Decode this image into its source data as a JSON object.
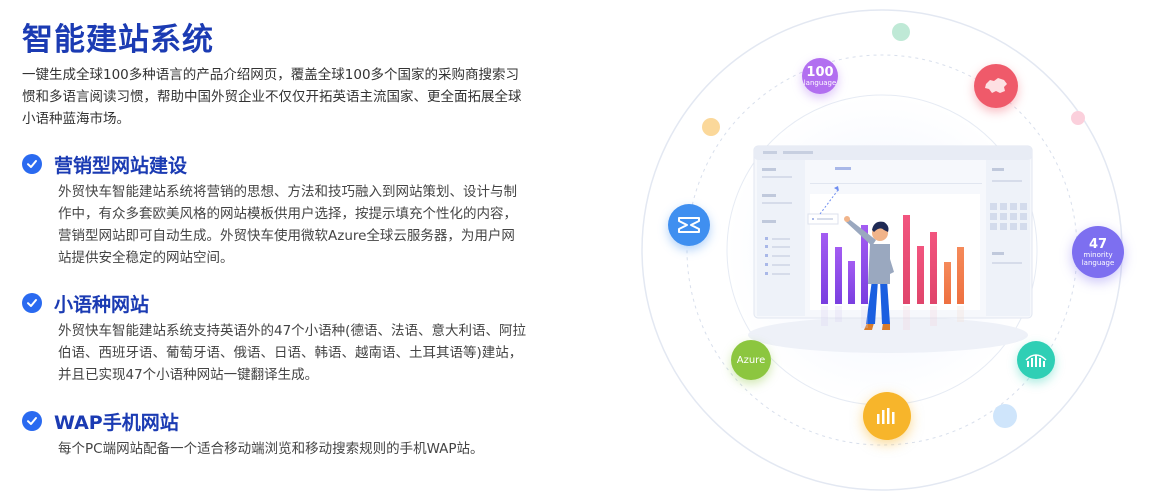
{
  "title": "智能建站系统",
  "intro": "一键生成全球100多种语言的产品介绍网页，覆盖全球100多个国家的采购商搜索习惯和多语言阅读习惯，帮助中国外贸企业不仅仅开拓英语主流国家、更全面拓展全球小语种蓝海市场。",
  "features": [
    {
      "title": "营销型网站建设",
      "desc": "外贸快车智能建站系统将营销的思想、方法和技巧融入到网站策划、设计与制作中，有众多套欧美风格的网站模板供用户选择，按提示填充个性化的内容，营销型网站即可自动生成。外贸快车使用微软Azure全球云服务器，为用户网站提供安全稳定的网站空间。"
    },
    {
      "title": "小语种网站",
      "desc": "外贸快车智能建站系统支持英语外的47个小语种(德语、法语、意大利语、阿拉伯语、西班牙语、葡萄牙语、俄语、日语、韩语、越南语、土耳其语等)建站，并且已实现47个小语种网站一键翻译生成。"
    },
    {
      "title": "WAP手机网站",
      "desc": "每个PC端网站配备一个适合移动端浏览和移动搜索规则的手机WAP站。"
    }
  ],
  "bubbles": {
    "language": {
      "big": "100",
      "small": "language",
      "color": "#b06cf0"
    },
    "minority": {
      "big": "47",
      "small1": "minority",
      "small2": "language",
      "color": "#7a6cf0"
    },
    "azure": {
      "label": "Azure",
      "color": "#8cc63f"
    },
    "china_icon": "china-map-icon",
    "wap_icon": "hourglass-icon",
    "signal_icon": "signal-icon",
    "bars_icon": "bar-chart-icon"
  },
  "colors": {
    "brand": "#1b3bb3",
    "check": "#2a6af0",
    "bar_purple": "#8a4be8",
    "bar_pink": "#e84b7a",
    "bar_orange": "#f07a4b"
  }
}
